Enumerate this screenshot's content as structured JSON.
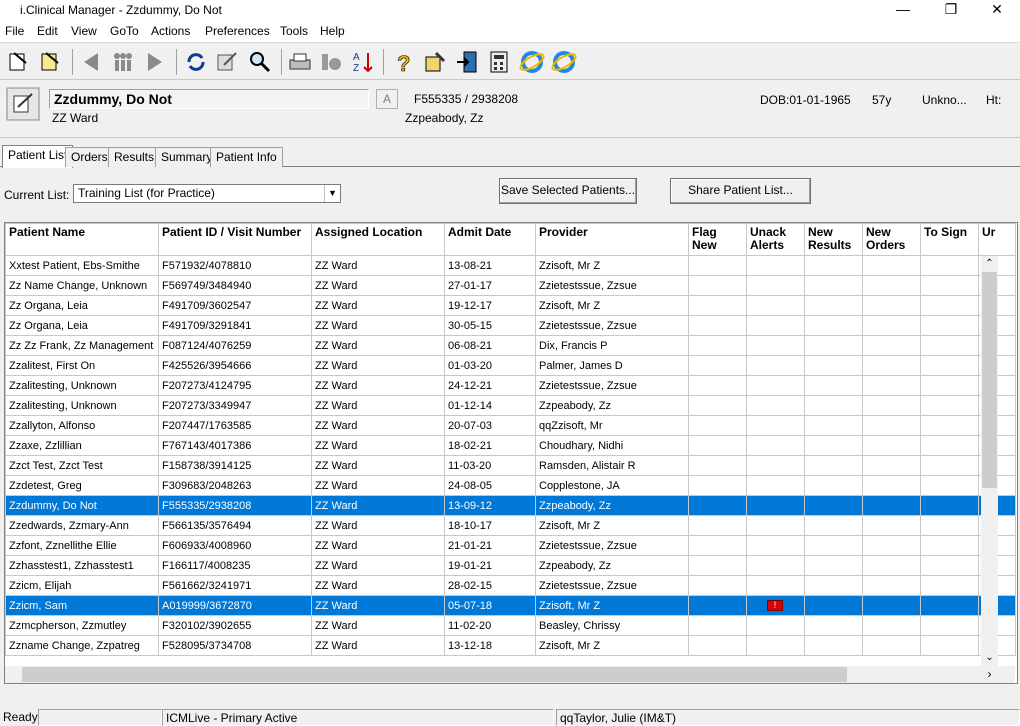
{
  "window": {
    "title": "i.Clinical Manager - Zzdummy, Do Not"
  },
  "menu": [
    "File",
    "Edit",
    "View",
    "GoTo",
    "Actions",
    "Preferences",
    "Tools",
    "Help"
  ],
  "banner": {
    "name": "Zzdummy, Do Not",
    "ward": "ZZ Ward",
    "a_box": "A",
    "patient_id": "F555335 / 2938208",
    "provider": "Zzpeabody, Zz",
    "dob": "DOB:01-01-1965",
    "age": "57y",
    "sex": "Unkno...",
    "height": "Ht:"
  },
  "tabs": [
    "Patient List",
    "Orders",
    "Results",
    "Summary",
    "Patient Info"
  ],
  "current_list": {
    "label": "Current List:",
    "value": "Training List (for Practice)"
  },
  "buttons": {
    "save_selected": "Save Selected Patients...",
    "share_list": "Share Patient List..."
  },
  "columns": [
    "Patient Name",
    "Patient ID / Visit Number",
    "Assigned Location",
    "Admit Date",
    "Provider",
    "Flag New",
    "Unack Alerts",
    "New Results",
    "New Orders",
    "To Sign",
    "Ur"
  ],
  "rows": [
    [
      "Xxtest Patient, Ebs-Smithe",
      "F571932/4078810",
      "ZZ Ward",
      "13-08-21",
      "Zzisoft, Mr Z"
    ],
    [
      "Zz Name Change, Unknown",
      "F569749/3484940",
      "ZZ Ward",
      "27-01-17",
      "Zzietestssue, Zzsue"
    ],
    [
      "Zz Organa, Leia",
      "F491709/3602547",
      "ZZ Ward",
      "19-12-17",
      "Zzisoft, Mr Z"
    ],
    [
      "Zz Organa, Leia",
      "F491709/3291841",
      "ZZ Ward",
      "30-05-15",
      "Zzietestssue, Zzsue"
    ],
    [
      "Zz Zz Frank, Zz Management",
      "F087124/4076259",
      "ZZ Ward",
      "06-08-21",
      "Dix, Francis P"
    ],
    [
      "Zzalitest, First On",
      "F425526/3954666",
      "ZZ Ward",
      "01-03-20",
      "Palmer, James D"
    ],
    [
      "Zzalitesting, Unknown",
      "F207273/4124795",
      "ZZ Ward",
      "24-12-21",
      "Zzietestssue, Zzsue"
    ],
    [
      "Zzalitesting, Unknown",
      "F207273/3349947",
      "ZZ Ward",
      "01-12-14",
      "Zzpeabody, Zz"
    ],
    [
      "Zzallyton, Alfonso",
      "F207447/1763585",
      "ZZ Ward",
      "20-07-03",
      "qqZzisoft, Mr"
    ],
    [
      "Zzaxe, Zzlillian",
      "F767143/4017386",
      "ZZ Ward",
      "18-02-21",
      "Choudhary, Nidhi"
    ],
    [
      "Zzct Test, Zzct Test",
      "F158738/3914125",
      "ZZ Ward",
      "11-03-20",
      "Ramsden, Alistair R"
    ],
    [
      "Zzdetest, Greg",
      "F309683/2048263",
      "ZZ Ward",
      "24-08-05",
      "Copplestone, JA"
    ],
    [
      "Zzdummy, Do Not",
      "F555335/2938208",
      "ZZ Ward",
      "13-09-12",
      "Zzpeabody, Zz"
    ],
    [
      "Zzedwards, Zzmary-Ann",
      "F566135/3576494",
      "ZZ Ward",
      "18-10-17",
      "Zzisoft, Mr Z"
    ],
    [
      "Zzfont, Zznellithe Ellie",
      "F606933/4008960",
      "ZZ Ward",
      "21-01-21",
      "Zzietestssue, Zzsue"
    ],
    [
      "Zzhasstest1, Zzhasstest1",
      "F166117/4008235",
      "ZZ Ward",
      "19-01-21",
      "Zzpeabody, Zz"
    ],
    [
      "Zzicm, Elijah",
      "F561662/3241971",
      "ZZ Ward",
      "28-02-15",
      "Zzietestssue, Zzsue"
    ],
    [
      "Zzicm, Sam",
      "A019999/3672870",
      "ZZ Ward",
      "05-07-18",
      "Zzisoft, Mr Z"
    ],
    [
      "Zzmcpherson, Zzmutley",
      "F320102/3902655",
      "ZZ Ward",
      "11-02-20",
      "Beasley, Chrissy"
    ],
    [
      "Zzname Change, Zzpatreg",
      "F528095/3734708",
      "ZZ Ward",
      "13-12-18",
      "Zzisoft, Mr Z"
    ]
  ],
  "status": {
    "ready": "Ready",
    "system": "ICMLive - Primary Active",
    "user": "qqTaylor, Julie (IM&T)"
  },
  "colors": {
    "selection": "#0078d7",
    "alert_flag": "#dd0000"
  }
}
